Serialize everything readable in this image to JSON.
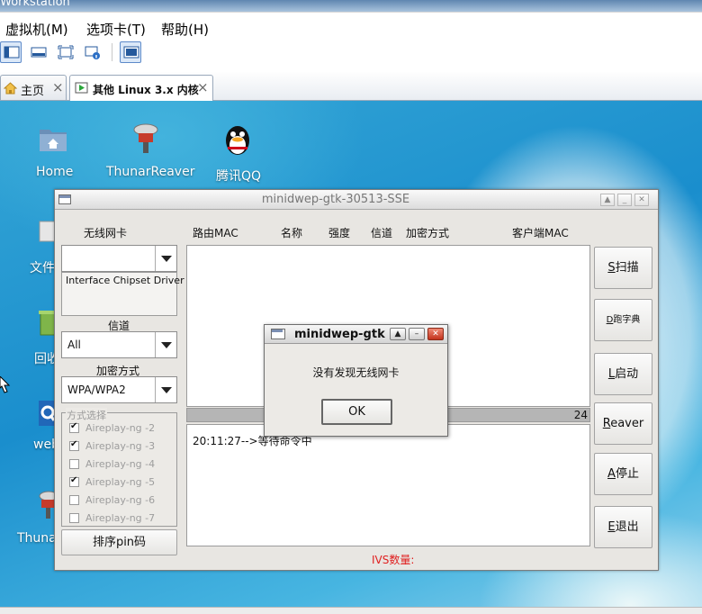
{
  "host": {
    "title_fragment": "e Workstation",
    "menu": [
      "虚拟机(M)",
      "选项卡(T)",
      "帮助(H)"
    ],
    "toolbar_icons": [
      "vm-view-icon",
      "console-view-icon",
      "fullscreen-icon",
      "vm-info-icon",
      "unity-icon"
    ],
    "tabs": [
      {
        "label": "主页",
        "icon": "home-icon"
      },
      {
        "label": "其他 Linux 3.x 内核",
        "icon": "vm-running-icon"
      }
    ],
    "close_glyph": "×"
  },
  "desktop": {
    "icons": [
      {
        "label": "Home",
        "icon": "home-folder-icon"
      },
      {
        "label": "ThunarReaver",
        "icon": "reaver-icon"
      },
      {
        "label": "腾讯QQ",
        "icon": "qq-icon"
      },
      {
        "label": "文件",
        "icon": "drive-icon"
      },
      {
        "label": "回收",
        "icon": "trash-icon"
      },
      {
        "label": "web",
        "icon": "web-icon"
      },
      {
        "label": "Thuna",
        "icon": "reaver-icon"
      }
    ]
  },
  "app": {
    "title": "minidwep-gtk-30513-SSE",
    "wlan_label": "无线网卡",
    "wlan_value": "",
    "chipset_text": "Interface Chipset Driver",
    "channel_label": "信道",
    "channel_value": "All",
    "encryption_label": "加密方式",
    "encryption_value": "WPA/WPA2",
    "mode_group_label": "方式选择",
    "modes": [
      {
        "label": "Aireplay-ng -2",
        "checked": true
      },
      {
        "label": "Aireplay-ng -3",
        "checked": true
      },
      {
        "label": "Aireplay-ng -4",
        "checked": false
      },
      {
        "label": "Aireplay-ng -5",
        "checked": true
      },
      {
        "label": "Aireplay-ng -6",
        "checked": false
      },
      {
        "label": "Aireplay-ng -7",
        "checked": false
      }
    ],
    "pin_button": "排序pin码",
    "columns": [
      "路由MAC",
      "名称",
      "强度",
      "信道",
      "加密方式",
      "客户端MAC"
    ],
    "progress_value": "24",
    "log_text": "20:11:27-->等待命令中",
    "ivs_label": "IVS数量:",
    "ivs_color": "#e02020",
    "buttons": [
      {
        "key": "S",
        "label": "扫描"
      },
      {
        "key": "D",
        "label": "跑字典"
      },
      {
        "key": "L",
        "label": "启动"
      },
      {
        "key": "R",
        "label": "eaver"
      },
      {
        "key": "A",
        "label": "停止"
      },
      {
        "key": "E",
        "label": "退出"
      }
    ]
  },
  "dialog": {
    "title": "minidwep-gtk",
    "message": "没有发现无线网卡",
    "ok": "OK"
  }
}
